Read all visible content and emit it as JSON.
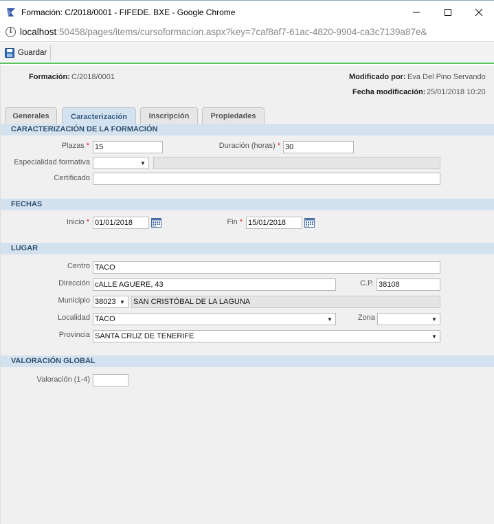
{
  "window": {
    "title": "Formación: C/2018/0001 - FIFEDE. BXE - Google Chrome",
    "url_host": "localhost",
    "url_rest": ":50458/pages/items/cursoformacion.aspx?key=7caf8af7-61ac-4820-9904-ca3c7139a87e&"
  },
  "toolbar": {
    "save_label": "Guardar"
  },
  "header": {
    "formacion_label": "Formación:",
    "formacion_value": "C/2018/0001",
    "modificado_label": "Modificado por:",
    "modificado_value": "Eva Del Pino Servando",
    "fecha_label": "Fecha modificación:",
    "fecha_value": "25/01/2018 10:20"
  },
  "tabs": [
    {
      "label": "Generales"
    },
    {
      "label": "Caracterización",
      "active": true
    },
    {
      "label": "Inscripción"
    },
    {
      "label": "Propiedades"
    }
  ],
  "sections": {
    "caracterizacion": "CARACTERIZACIÓN DE LA FORMACIÓN",
    "fechas": "FECHAS",
    "lugar": "LUGAR",
    "valoracion": "VALORACIÓN GLOBAL"
  },
  "fields": {
    "plazas": {
      "label": "Plazas",
      "value": "15"
    },
    "duracion": {
      "label": "Duración (horas)",
      "value": "30"
    },
    "especialidad": {
      "label": "Especialidad formativa",
      "value": "",
      "desc": ""
    },
    "certificado": {
      "label": "Certificado",
      "value": ""
    },
    "inicio": {
      "label": "Inicio",
      "value": "01/01/2018"
    },
    "fin": {
      "label": "Fin",
      "value": "15/01/2018"
    },
    "centro": {
      "label": "Centro",
      "value": "TACO"
    },
    "direccion": {
      "label": "Dirección",
      "value": "cALLE AGUERE, 43"
    },
    "cp": {
      "label": "C.P.",
      "value": "38108"
    },
    "municipio": {
      "label": "Municipio",
      "code": "38023",
      "name": "SAN CRISTÓBAL DE LA LAGUNA"
    },
    "localidad": {
      "label": "Localidad",
      "value": "TACO"
    },
    "zona": {
      "label": "Zona",
      "value": ""
    },
    "provincia": {
      "label": "Provincia",
      "value": "SANTA CRUZ DE TENERIFE"
    },
    "valoracion": {
      "label": "Valoración (1-4)",
      "value": ""
    }
  },
  "colors": {
    "accent_green": "#58c45c",
    "section_bg": "#d3e2ee",
    "required": "#dd2222"
  }
}
